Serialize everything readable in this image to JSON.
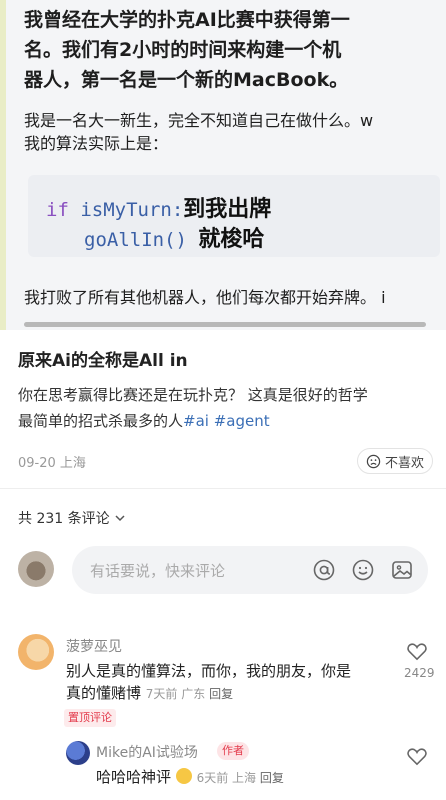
{
  "post_image": {
    "para1_line1": "我曾经在大学的扑克AI比赛中获得第一",
    "para1_line2": "名。我们有2小时的时间来构建一个机",
    "para1_line3": "器人，第一名是一个新的MacBook。",
    "para2_line1": "我是一名大一新生，完全不知道自己在做什么。w",
    "para2_line2": "我的算法实际上是：",
    "code_kw": "if",
    "code_line1": "isMyTurn:",
    "code_line2": "goAllIn()",
    "overlay_line1": "到我出牌",
    "overlay_line2": "就梭哈",
    "para3": "我打败了所有其他机器人，他们每次都开始弃牌。 i"
  },
  "post": {
    "title": "原来Ai的全称是All in",
    "body_line1": "你在思考赢得比赛还是在玩扑克？ 这真是很好的哲学",
    "body_line2_text": "最简单的招式杀最多的人",
    "body_line2_tags": "#ai #agent",
    "date_location": "09-20 上海",
    "dislike_label": "不喜欢"
  },
  "comments_header": {
    "count_label": "共 231 条评论"
  },
  "comment_input": {
    "placeholder": "有话要说，快来评论"
  },
  "comments": [
    {
      "name": "菠萝巫见",
      "text_line1": "别人是真的懂算法，而你，我的朋友，你是",
      "text_line2": "真的懂赌博",
      "time_location": "7天前 广东",
      "reply": "回复",
      "badge": "置顶评论",
      "likes": "2429"
    },
    {
      "name": "Mike的AI试验场",
      "author_badge": "作者",
      "text": "哈哈哈神评",
      "time_location": "6天前 上海",
      "reply": "回复"
    }
  ],
  "colors": {
    "tag_blue": "#3b6fb6",
    "badge_red": "#e33b4c"
  }
}
